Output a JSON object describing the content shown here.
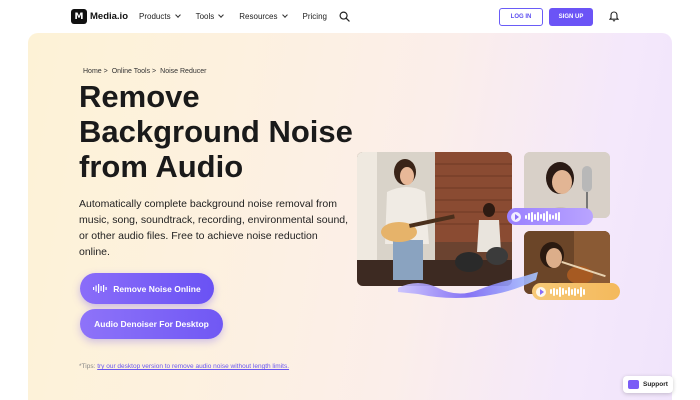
{
  "nav": {
    "logo_mark": "M",
    "logo_text": "Media.io",
    "items": [
      {
        "label": "Products",
        "dropdown": true
      },
      {
        "label": "Tools",
        "dropdown": true
      },
      {
        "label": "Resources",
        "dropdown": true
      },
      {
        "label": "Pricing",
        "dropdown": false
      }
    ],
    "login_label": "LOG IN",
    "signup_label": "SIGN UP",
    "icons": [
      "search-icon",
      "bell-icon"
    ]
  },
  "breadcrumb": [
    "Home >",
    "Online Tools >",
    "Noise Reducer"
  ],
  "hero": {
    "title_lines": [
      "Remove",
      "Background Noise",
      "from Audio"
    ],
    "description": "Automatically complete background noise removal from music, song, soundtrack, recording, environmental sound, or other audio files. Free to achieve noise reduction online.",
    "cta_primary": "Remove Noise Online",
    "cta_secondary": "Audio Denoiser For Desktop",
    "tips_prefix": "*Tips:",
    "tips_link": "try our desktop version to remove audio noise without length limits."
  },
  "support": {
    "label": "Support"
  },
  "colors": {
    "accent": "#6b54f6",
    "accent_light": "#8a6df9",
    "pill_orange": "#f4b95c"
  }
}
